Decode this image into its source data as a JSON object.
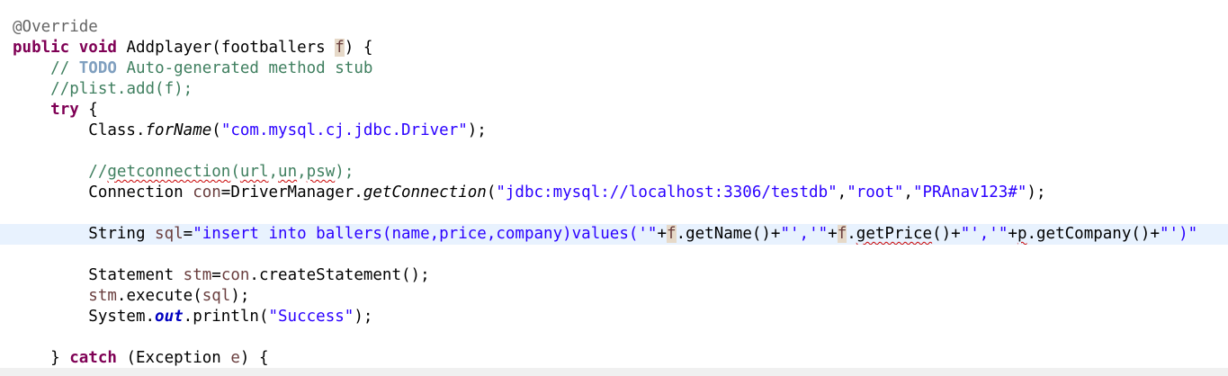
{
  "editor": {
    "lines": [
      {
        "id": "l1",
        "segments": [
          {
            "t": "@Override",
            "c": "ann"
          }
        ]
      },
      {
        "id": "l2",
        "segments": [
          {
            "t": "public",
            "c": "kw"
          },
          {
            "t": " "
          },
          {
            "t": "void",
            "c": "kw"
          },
          {
            "t": " Addplayer(footballers "
          },
          {
            "t": "f",
            "c": "var hl"
          },
          {
            "t": ") {"
          }
        ]
      },
      {
        "id": "l3",
        "segments": [
          {
            "t": "    "
          },
          {
            "t": "// ",
            "c": "cm"
          },
          {
            "t": "TODO",
            "c": "todo"
          },
          {
            "t": " Auto-generated method stub",
            "c": "cm"
          }
        ]
      },
      {
        "id": "l4",
        "segments": [
          {
            "t": "    "
          },
          {
            "t": "//plist.add(f);",
            "c": "cm"
          }
        ]
      },
      {
        "id": "l5",
        "segments": [
          {
            "t": "    "
          },
          {
            "t": "try",
            "c": "kw"
          },
          {
            "t": " {"
          }
        ]
      },
      {
        "id": "l6",
        "segments": [
          {
            "t": "        Class."
          },
          {
            "t": "forName",
            "c": "it"
          },
          {
            "t": "("
          },
          {
            "t": "\"com.mysql.cj.jdbc.Driver\"",
            "c": "str"
          },
          {
            "t": ");"
          }
        ]
      },
      {
        "id": "l7",
        "segments": []
      },
      {
        "id": "l8",
        "segments": [
          {
            "t": "        "
          },
          {
            "t": "//",
            "c": "cm"
          },
          {
            "t": "getconnection",
            "c": "cm squig"
          },
          {
            "t": "(",
            "c": "cm"
          },
          {
            "t": "url",
            "c": "cm squig"
          },
          {
            "t": ",",
            "c": "cm"
          },
          {
            "t": "un",
            "c": "cm squig"
          },
          {
            "t": ",",
            "c": "cm"
          },
          {
            "t": "psw",
            "c": "cm squig"
          },
          {
            "t": ");",
            "c": "cm"
          }
        ]
      },
      {
        "id": "l9",
        "segments": [
          {
            "t": "        Connection "
          },
          {
            "t": "con",
            "c": "var"
          },
          {
            "t": "=DriverManager."
          },
          {
            "t": "getConnection",
            "c": "it"
          },
          {
            "t": "("
          },
          {
            "t": "\"jdbc:mysql://localhost:3306/testdb\"",
            "c": "str"
          },
          {
            "t": ","
          },
          {
            "t": "\"root\"",
            "c": "str"
          },
          {
            "t": ","
          },
          {
            "t": "\"PRAnav123#\"",
            "c": "str"
          },
          {
            "t": ");"
          }
        ]
      },
      {
        "id": "l10",
        "segments": []
      },
      {
        "id": "l11",
        "current": true,
        "segments": [
          {
            "t": "        String "
          },
          {
            "t": "sql",
            "c": "var"
          },
          {
            "t": "="
          },
          {
            "t": "\"insert into ballers(name,price,company)values('\"",
            "c": "str"
          },
          {
            "t": "+"
          },
          {
            "t": "f",
            "c": "var hl"
          },
          {
            "t": ".getName()+"
          },
          {
            "t": "\"','\"",
            "c": "str"
          },
          {
            "t": "+"
          },
          {
            "t": "f",
            "c": "var hl"
          },
          {
            "t": "."
          },
          {
            "t": "getPrice",
            "c": "squig"
          },
          {
            "t": "()+"
          },
          {
            "t": "\"','\"",
            "c": "str"
          },
          {
            "t": "+"
          },
          {
            "t": "p",
            "c": "squig"
          },
          {
            "t": ".getCompany()+"
          },
          {
            "t": "\"')\"",
            "c": "str"
          }
        ]
      },
      {
        "id": "l12",
        "segments": []
      },
      {
        "id": "l13",
        "segments": [
          {
            "t": "        Statement "
          },
          {
            "t": "stm",
            "c": "var"
          },
          {
            "t": "="
          },
          {
            "t": "con",
            "c": "var"
          },
          {
            "t": ".createStatement();"
          }
        ]
      },
      {
        "id": "l14",
        "segments": [
          {
            "t": "        "
          },
          {
            "t": "stm",
            "c": "var"
          },
          {
            "t": ".execute("
          },
          {
            "t": "sql",
            "c": "var"
          },
          {
            "t": ");"
          }
        ]
      },
      {
        "id": "l15",
        "segments": [
          {
            "t": "        System."
          },
          {
            "t": "out",
            "c": "field"
          },
          {
            "t": ".println("
          },
          {
            "t": "\"Success\"",
            "c": "str"
          },
          {
            "t": ");"
          }
        ]
      },
      {
        "id": "l16",
        "segments": []
      },
      {
        "id": "l17",
        "segments": [
          {
            "t": "    } "
          },
          {
            "t": "catch",
            "c": "kw"
          },
          {
            "t": " (Exception "
          },
          {
            "t": "e",
            "c": "var"
          },
          {
            "t": ") {"
          }
        ]
      }
    ]
  }
}
